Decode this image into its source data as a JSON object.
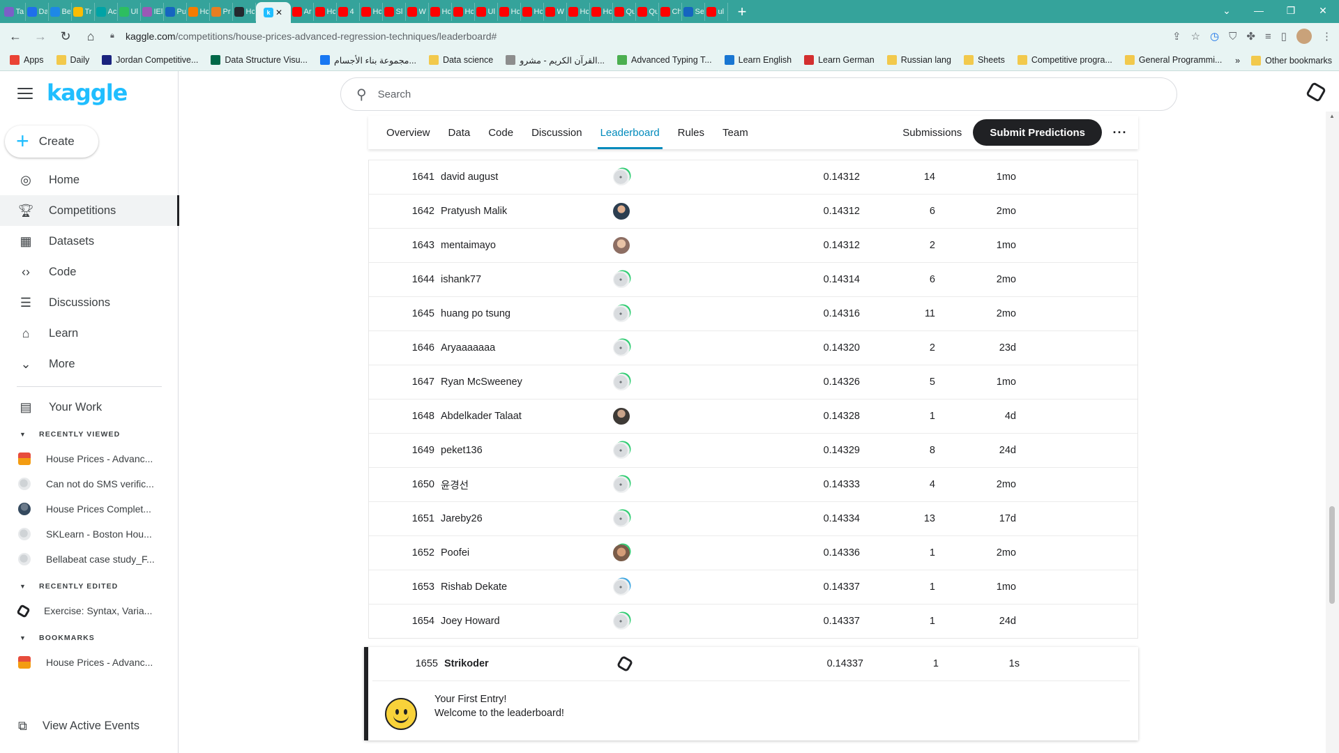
{
  "browser": {
    "tabs": [
      {
        "label": "Ta",
        "color": "#7b5fc7"
      },
      {
        "label": "Da",
        "color": "#1f6feb"
      },
      {
        "label": "Be",
        "color": "#1e88e5"
      },
      {
        "label": "Tr",
        "color": "#fbbc04"
      },
      {
        "label": "Ac",
        "color": "#00a3a6"
      },
      {
        "label": "Ul",
        "color": "#2dbe60"
      },
      {
        "label": "IEl",
        "color": "#9b59b6"
      },
      {
        "label": "Pu",
        "color": "#1565c0"
      },
      {
        "label": "Hc",
        "color": "#f57c00"
      },
      {
        "label": "Pr",
        "color": "#e67e22"
      },
      {
        "label": "Hc",
        "color": "#24292f"
      },
      {
        "label": "",
        "color": "#20beff",
        "active": true
      },
      {
        "label": "Ar",
        "color": "#ff0000"
      },
      {
        "label": "Hc",
        "color": "#ff0000"
      },
      {
        "label": "4",
        "color": "#ff0000"
      },
      {
        "label": "Hc",
        "color": "#ff0000"
      },
      {
        "label": "Sl",
        "color": "#ff0000"
      },
      {
        "label": "W",
        "color": "#ff0000"
      },
      {
        "label": "Hc",
        "color": "#ff0000"
      },
      {
        "label": "Hc",
        "color": "#ff0000"
      },
      {
        "label": "Ul",
        "color": "#ff0000"
      },
      {
        "label": "Hc",
        "color": "#ff0000"
      },
      {
        "label": "Hc",
        "color": "#ff0000"
      },
      {
        "label": "W",
        "color": "#ff0000"
      },
      {
        "label": "Hc",
        "color": "#ff0000"
      },
      {
        "label": "Hc",
        "color": "#ff0000"
      },
      {
        "label": "Qu",
        "color": "#ff0000"
      },
      {
        "label": "Qu",
        "color": "#ff0000"
      },
      {
        "label": "Ch",
        "color": "#ff0000"
      },
      {
        "label": "Se",
        "color": "#1565c0"
      },
      {
        "label": "ul",
        "color": "#ff0000"
      }
    ],
    "url_host": "kaggle.com",
    "url_path": "/competitions/house-prices-advanced-regression-techniques/leaderboard#",
    "bookmarks": [
      {
        "label": "Apps",
        "icon": "apps-grid-icon"
      },
      {
        "label": "Daily",
        "icon": "folder-icon"
      },
      {
        "label": "Jordan Competitive...",
        "icon": "jcp-icon"
      },
      {
        "label": "Data Structure Visu...",
        "icon": "usf-icon"
      },
      {
        "label": "مجموعة بناء الأجسام...",
        "icon": "facebook-icon"
      },
      {
        "label": "Data science",
        "icon": "folder-icon"
      },
      {
        "label": "القرآن الكريم - مشرو...",
        "icon": "quran-icon"
      },
      {
        "label": "Advanced Typing T...",
        "icon": "typing-icon"
      },
      {
        "label": "Learn English",
        "icon": "learn-english-icon"
      },
      {
        "label": "Learn German",
        "icon": "learn-german-icon"
      },
      {
        "label": "Russian lang",
        "icon": "folder-icon"
      },
      {
        "label": "Sheets",
        "icon": "folder-icon"
      },
      {
        "label": "Competitive progra...",
        "icon": "folder-icon"
      },
      {
        "label": "General Programmi...",
        "icon": "folder-icon"
      }
    ],
    "bookmarks_overflow": "»",
    "other_bookmarks": "Other bookmarks"
  },
  "sidebar": {
    "logo": "kaggle",
    "create_label": "Create",
    "nav": [
      {
        "label": "Home",
        "icon": "compass-icon",
        "active": false
      },
      {
        "label": "Competitions",
        "icon": "trophy-icon",
        "active": true
      },
      {
        "label": "Datasets",
        "icon": "table-icon",
        "active": false
      },
      {
        "label": "Code",
        "icon": "code-icon",
        "active": false
      },
      {
        "label": "Discussions",
        "icon": "discussion-icon",
        "active": false
      },
      {
        "label": "Learn",
        "icon": "graduation-cap-icon",
        "active": false
      },
      {
        "label": "More",
        "icon": "chevron-down-icon",
        "active": false
      }
    ],
    "your_work": "Your Work",
    "recently_viewed_title": "RECENTLY VIEWED",
    "recently_viewed": [
      {
        "label": "House Prices - Advanc...",
        "icon": "house-prices-icon"
      },
      {
        "label": "Can not do SMS verific...",
        "icon": "default-avatar-icon"
      },
      {
        "label": "House Prices Complet...",
        "icon": "user-photo-icon"
      },
      {
        "label": "SKLearn - Boston Hou...",
        "icon": "default-avatar-icon"
      },
      {
        "label": "Bellabeat case study_F...",
        "icon": "default-avatar-icon"
      }
    ],
    "recently_edited_title": "RECENTLY EDITED",
    "recently_edited": [
      {
        "label": "Exercise: Syntax, Varia...",
        "icon": "kaggle-hex-icon"
      }
    ],
    "bookmarks_title": "BOOKMARKS",
    "bookmarks": [
      {
        "label": "House Prices - Advanc...",
        "icon": "house-prices-icon"
      }
    ],
    "view_active_events": "View Active Events"
  },
  "search": {
    "placeholder": "Search"
  },
  "competition_tabs": {
    "tabs": [
      "Overview",
      "Data",
      "Code",
      "Discussion",
      "Leaderboard",
      "Rules",
      "Team"
    ],
    "active": "Leaderboard",
    "submissions": "Submissions",
    "submit": "Submit Predictions",
    "more": "···"
  },
  "leaderboard": {
    "rows": [
      {
        "rank": "1641",
        "team": "david august",
        "avatar": "default",
        "score": "0.14312",
        "entries": "14",
        "last": "1mo"
      },
      {
        "rank": "1642",
        "team": "Pratyush Malik",
        "avatar": "photo1",
        "score": "0.14312",
        "entries": "6",
        "last": "2mo"
      },
      {
        "rank": "1643",
        "team": "mentaimayo",
        "avatar": "photo2",
        "score": "0.14312",
        "entries": "2",
        "last": "1mo"
      },
      {
        "rank": "1644",
        "team": "ishank77",
        "avatar": "default",
        "score": "0.14314",
        "entries": "6",
        "last": "2mo"
      },
      {
        "rank": "1645",
        "team": "huang po tsung",
        "avatar": "default",
        "score": "0.14316",
        "entries": "11",
        "last": "2mo"
      },
      {
        "rank": "1646",
        "team": "Aryaaaaaaa",
        "avatar": "default",
        "score": "0.14320",
        "entries": "2",
        "last": "23d"
      },
      {
        "rank": "1647",
        "team": "Ryan McSweeney",
        "avatar": "default",
        "score": "0.14326",
        "entries": "5",
        "last": "1mo"
      },
      {
        "rank": "1648",
        "team": "Abdelkader Talaat",
        "avatar": "photo3",
        "score": "0.14328",
        "entries": "1",
        "last": "4d"
      },
      {
        "rank": "1649",
        "team": "peket136",
        "avatar": "default",
        "score": "0.14329",
        "entries": "8",
        "last": "24d"
      },
      {
        "rank": "1650",
        "team": "윤경선",
        "avatar": "default",
        "score": "0.14333",
        "entries": "4",
        "last": "2mo"
      },
      {
        "rank": "1651",
        "team": "Jareby26",
        "avatar": "default",
        "score": "0.14334",
        "entries": "13",
        "last": "17d"
      },
      {
        "rank": "1652",
        "team": "Poofei",
        "avatar": "photo4",
        "score": "0.14336",
        "entries": "1",
        "last": "2mo"
      },
      {
        "rank": "1653",
        "team": "Rishab Dekate",
        "avatar": "blue",
        "score": "0.14337",
        "entries": "1",
        "last": "1mo"
      },
      {
        "rank": "1654",
        "team": "Joey Howard",
        "avatar": "default",
        "score": "0.14337",
        "entries": "1",
        "last": "24d"
      }
    ],
    "mine": {
      "rank": "1655",
      "team": "Strikoder",
      "score": "0.14337",
      "entries": "1",
      "last": "1s"
    },
    "first_entry_line1": "Your First Entry!",
    "first_entry_line2": "Welcome to the leaderboard!"
  }
}
